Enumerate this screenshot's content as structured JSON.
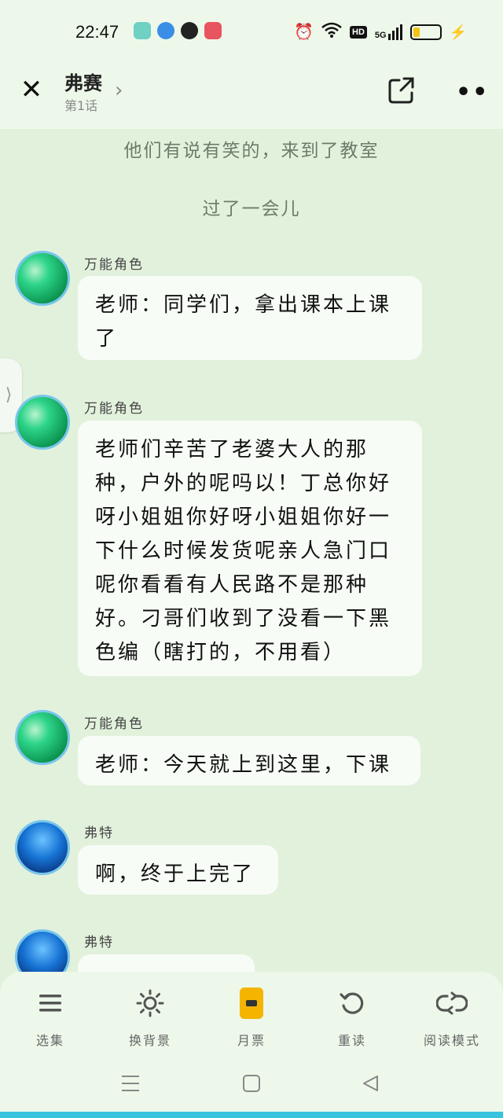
{
  "status_bar": {
    "time": "22:47",
    "signal_label": "5G",
    "hd_label": "HD",
    "battery_level": 0.25,
    "icons": [
      "alarm-icon",
      "wifi-icon",
      "hd-icon",
      "signal-icon",
      "battery-icon",
      "charging-icon"
    ],
    "app_icons": [
      "app-icon-1",
      "app-icon-2",
      "app-icon-3",
      "app-icon-4"
    ]
  },
  "header": {
    "title": "弗赛",
    "episode": "第1话"
  },
  "chat": {
    "narrations": [
      "他们有说有笑的，来到了教室",
      "过了一会儿"
    ],
    "messages": [
      {
        "speaker": "万能角色",
        "text": "老师：同学们，拿出课本上课了"
      },
      {
        "speaker": "万能角色",
        "text": "老师们辛苦了老婆大人的那种，户外的呢吗以！丁总你好呀小姐姐你好呀小姐姐你好一下什么时候发货呢亲人急门口呢你看看有人民路不是那种好。刁哥们收到了没看一下黑色编（瞎打的，不用看）"
      },
      {
        "speaker": "万能角色",
        "text": "老师：今天就上到这里，下课"
      },
      {
        "speaker": "弗特",
        "text": "啊，终于上完了"
      },
      {
        "speaker": "弗特",
        "text": ""
      }
    ]
  },
  "bottom_bar": {
    "tabs": [
      {
        "label": "选集",
        "icon": "list-icon"
      },
      {
        "label": "换背景",
        "icon": "sun-icon"
      },
      {
        "label": "月票",
        "icon": "ticket-icon"
      },
      {
        "label": "重读",
        "icon": "replay-icon"
      },
      {
        "label": "阅读模式",
        "icon": "loop-icon"
      }
    ]
  },
  "colors": {
    "background": "#e2f1dc",
    "header_bg": "#edf8ea",
    "bubble_bg": "#f7fcf6",
    "avatar_ring": "#79c6ea",
    "accent_strip": "#38c3de"
  }
}
